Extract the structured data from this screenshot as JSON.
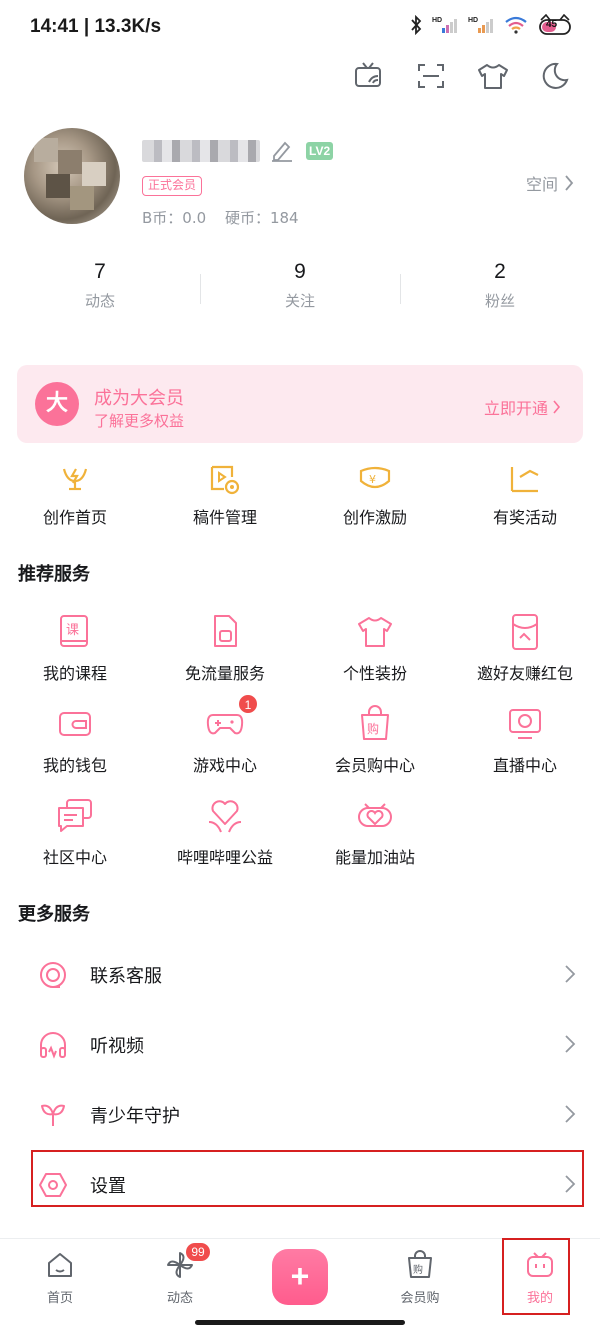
{
  "status_bar": {
    "time_speed": "14:41 | 13.3K/s",
    "battery": "45"
  },
  "profile": {
    "level": "LV2",
    "vip_badge": "正式会员",
    "b_coin": "B币：0.0",
    "coin": "硬币：184",
    "space_label": "空间"
  },
  "stats": [
    {
      "num": "7",
      "label": "动态"
    },
    {
      "num": "9",
      "label": "关注"
    },
    {
      "num": "2",
      "label": "粉丝"
    }
  ],
  "vip_banner": {
    "icon_char": "大",
    "title": "成为大会员",
    "subtitle": "了解更多权益",
    "action": "立即开通"
  },
  "creator": [
    {
      "label": "创作首页",
      "icon": "creator-home-icon"
    },
    {
      "label": "稿件管理",
      "icon": "manuscript-icon"
    },
    {
      "label": "创作激励",
      "icon": "incentive-icon"
    },
    {
      "label": "有奖活动",
      "icon": "reward-activity-icon"
    }
  ],
  "recommended": {
    "title": "推荐服务",
    "items": [
      {
        "label": "我的课程",
        "icon": "course-icon"
      },
      {
        "label": "免流量服务",
        "icon": "sim-card-icon"
      },
      {
        "label": "个性装扮",
        "icon": "shirt-icon"
      },
      {
        "label": "邀好友赚红包",
        "icon": "red-packet-icon"
      },
      {
        "label": "我的钱包",
        "icon": "wallet-icon"
      },
      {
        "label": "游戏中心",
        "icon": "gamepad-icon",
        "badge": "1"
      },
      {
        "label": "会员购中心",
        "icon": "shopping-bag-icon"
      },
      {
        "label": "直播中心",
        "icon": "live-icon"
      },
      {
        "label": "社区中心",
        "icon": "community-icon"
      },
      {
        "label": "哔哩哔哩公益",
        "icon": "charity-heart-icon"
      },
      {
        "label": "能量加油站",
        "icon": "energy-station-icon"
      }
    ]
  },
  "more": {
    "title": "更多服务",
    "items": [
      {
        "label": "联系客服",
        "icon": "customer-service-icon"
      },
      {
        "label": "听视频",
        "icon": "headphones-icon"
      },
      {
        "label": "青少年守护",
        "icon": "sprout-icon"
      },
      {
        "label": "设置",
        "icon": "settings-icon"
      }
    ]
  },
  "bottom_nav": {
    "home": "首页",
    "dynamic": "动态",
    "dynamic_badge": "99",
    "plus": "+",
    "shop": "会员购",
    "mine": "我的"
  },
  "colors": {
    "accent": "#fb7299",
    "creator_icon": "#f0b23a",
    "highlight": "#d62020"
  }
}
